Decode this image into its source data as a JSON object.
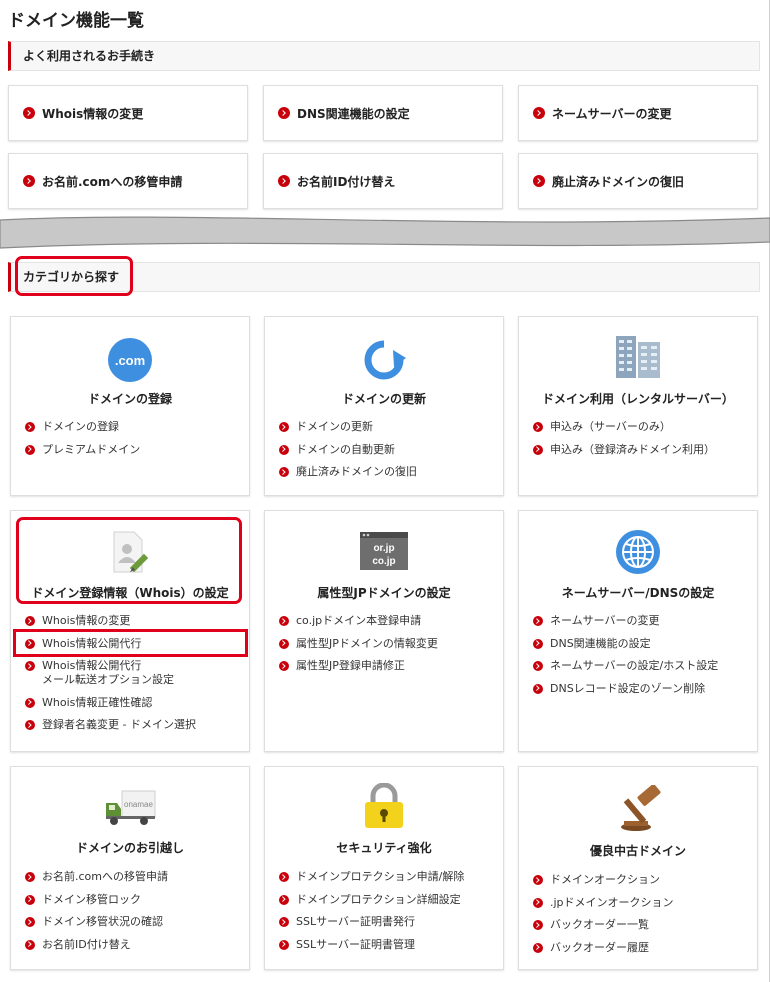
{
  "page": {
    "title": "ドメイン機能一覧"
  },
  "colors": {
    "accent": "#c7000b",
    "highlight": "#e0001b",
    "icon_blue": "#3f8fe0"
  },
  "frequent": {
    "heading": "よく利用されるお手続き",
    "buttons": [
      {
        "label": "Whois情報の変更"
      },
      {
        "label": "DNS関連機能の設定"
      },
      {
        "label": "ネームサーバーの変更"
      },
      {
        "label": "お名前.comへの移管申請"
      },
      {
        "label": "お名前ID付け替え"
      },
      {
        "label": "廃止済みドメインの復旧"
      }
    ]
  },
  "category": {
    "heading": "カテゴリから探す",
    "cards": [
      {
        "title": "ドメインの登録",
        "icon": "dotcom-icon",
        "icon_text": ".com",
        "links": [
          "ドメインの登録",
          "プレミアムドメイン"
        ]
      },
      {
        "title": "ドメインの更新",
        "icon": "refresh-arrow-icon",
        "links": [
          "ドメインの更新",
          "ドメインの自動更新",
          "廃止済みドメインの復旧"
        ]
      },
      {
        "title": "ドメイン利用（レンタルサーバー）",
        "icon": "server-building-icon",
        "links": [
          "申込み（サーバーのみ）",
          "申込み（登録済みドメイン利用）"
        ]
      },
      {
        "title": "ドメイン登録情報（Whois）の設定",
        "icon": "user-document-icon",
        "links": [
          "Whois情報の変更",
          "Whois情報公開代行",
          "Whois情報公開代行\nメール転送オプション設定",
          "Whois情報正確性確認",
          "登録者名義変更 - ドメイン選択"
        ]
      },
      {
        "title": "属性型JPドメインの設定",
        "icon": "jp-domain-icon",
        "icon_lines": [
          "or.jp",
          "co.jp"
        ],
        "links": [
          "co.jpドメイン本登録申請",
          "属性型JPドメインの情報変更",
          "属性型JP登録申請修正"
        ]
      },
      {
        "title": "ネームサーバー/DNSの設定",
        "icon": "globe-icon",
        "links": [
          "ネームサーバーの変更",
          "DNS関連機能の設定",
          "ネームサーバーの設定/ホスト設定",
          "DNSレコード設定のゾーン削除"
        ]
      },
      {
        "title": "ドメインのお引越し",
        "icon": "moving-truck-icon",
        "icon_text": "onamae",
        "links": [
          "お名前.comへの移管申請",
          "ドメイン移管ロック",
          "ドメイン移管状況の確認",
          "お名前ID付け替え"
        ]
      },
      {
        "title": "セキュリティ強化",
        "icon": "padlock-icon",
        "links": [
          "ドメインプロテクション申請/解除",
          "ドメインプロテクション詳細設定",
          "SSLサーバー証明書発行",
          "SSLサーバー証明書管理"
        ]
      },
      {
        "title": "優良中古ドメイン",
        "icon": "auction-gavel-icon",
        "links": [
          "ドメインオークション",
          ".jpドメインオークション",
          "バックオーダー一覧",
          "バックオーダー履歴"
        ]
      }
    ]
  }
}
